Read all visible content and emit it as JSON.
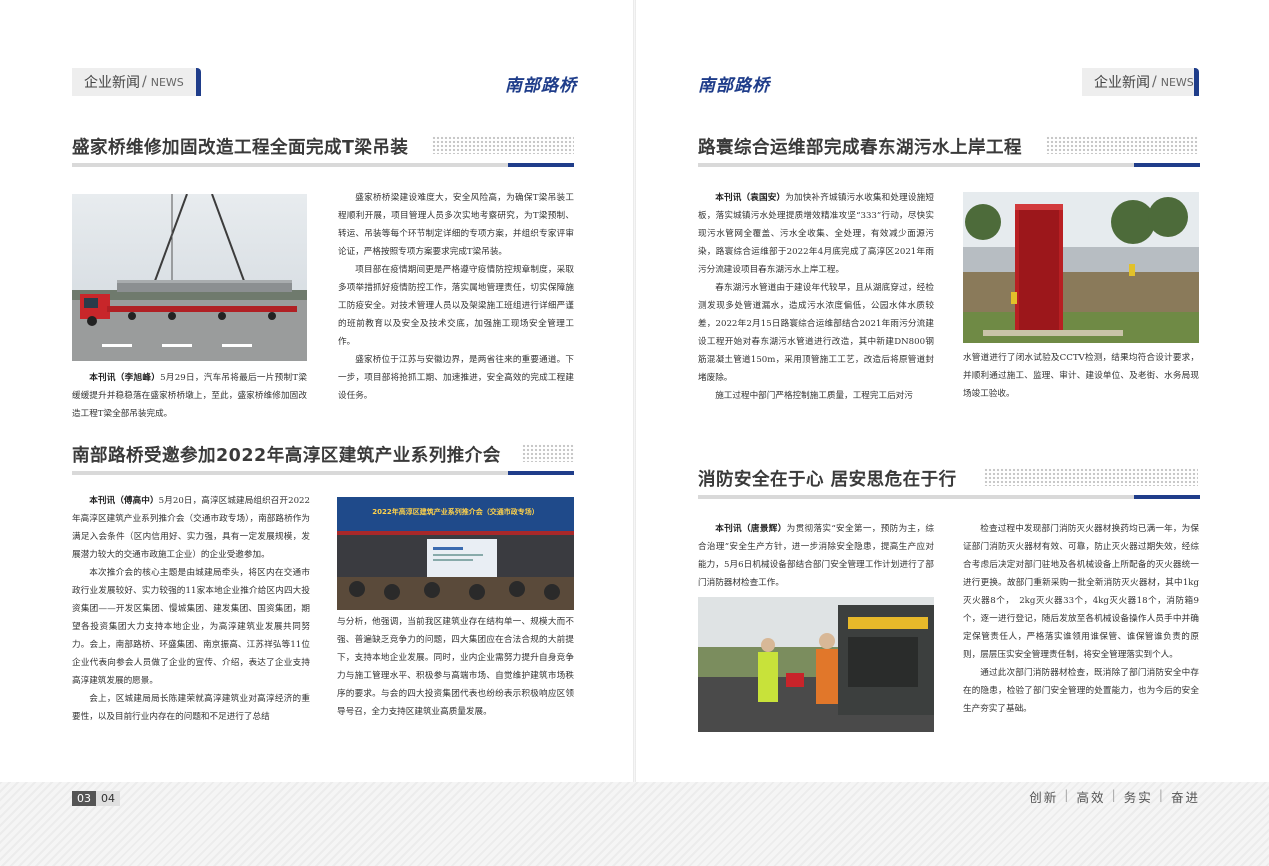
{
  "header": {
    "section_label": "企业新闻",
    "section_sub": "NEWS",
    "brand": "南部路桥"
  },
  "colors": {
    "accent": "#1f3d8a"
  },
  "article1": {
    "headline": "盛家桥维修加固改造工程全面完成T梁吊装",
    "caption_lead": "本刊讯（李旭峰）",
    "caption_body": "5月29日，汽车吊将最后一片预制T梁缓缓提升并稳稳落在盛家桥桥墩上，至此，盛家桥维修加固改造工程T梁全部吊装完成。",
    "paragraphs": [
      "盛家桥桥梁建设难度大，安全风险高，为确保T梁吊装工程顺利开展，项目管理人员多次实地考察研究，为T梁预制、转运、吊装等每个环节制定详细的专项方案，并组织专家评审论证，严格按照专项方案要求完成T梁吊装。",
      "项目部在疫情期间更是严格遵守疫情防控规章制度，采取多项举措抓好疫情防控工作，落实属地管理责任，切实保障施工防疫安全。对技术管理人员以及架梁施工班组进行详细严谨的班前教育以及安全及技术交底，加强施工现场安全管理工作。",
      "盛家桥位于江苏与安徽边界，是两省往来的重要通道。下一步，项目部将抢抓工期、加速推进，安全高效的完成工程建设任务。"
    ]
  },
  "article2": {
    "headline": "南部路桥受邀参加2022年高淳区建筑产业系列推介会",
    "lead": "本刊讯（傅高中）",
    "paragraph1_body": "5月20日，高淳区城建局组织召开2022年高淳区建筑产业系列推介会（交通市政专场），南部路桥作为满足入会条件（区内信用好、实力强，具有一定发展规模，发展潜力较大的交通市政施工企业）的企业受邀参加。",
    "paragraph2": "本次推介会的核心主题是由城建局牵头，将区内在交通市政行业发展较好、实力较强的11家本地企业推介给区内四大投资集团——开发区集团、慢城集团、建发集团、国资集团，期望各投资集团大力支持本地企业，为高淳建筑业发展共同努力。会上，南部路桥、环盛集团、南京振高、江苏祥弘等11位企业代表向参会人员做了企业的宣传、介绍，表达了企业支持高淳建筑发展的愿景。",
    "paragraph3": "会上，区城建局局长陈建荣就高淳建筑业对高淳经济的重要性，以及目前行业内存在的问题和不足进行了总结",
    "right_col": "与分析，他强调，当前我区建筑业存在结构单一、规模大而不强、普遍缺乏竞争力的问题，四大集团应在合法合规的大前提下，支持本地企业发展。同时，业内企业需努力提升自身竞争力与施工管理水平、积极参与高端市场、自觉维护建筑市场秩序的要求。与会的四大投资集团代表也纷纷表示积极响应区领导号召，全力支持区建筑业高质量发展。",
    "banner_text": "2022年高淳区建筑产业系列推介会（交通市政专场）"
  },
  "article3": {
    "headline": "路寰综合运维部完成春东湖污水上岸工程",
    "lead": "本刊讯（袁国安）",
    "paragraph1_body": "为加快补齐城镇污水收集和处理设施短板，落实城镇污水处理提质增效精准攻坚“333”行动，尽快实现污水管网全覆盖、污水全收集、全处理，有效减少面源污染，路寰综合运维部于2022年4月底完成了高淳区2021年雨污分流建设项目春东湖污水上岸工程。",
    "paragraph2": "春东湖污水管道由于建设年代较早，且从湖底穿过，经检测发现多处管道漏水，造成污水浓度偏低，公园水体水质较差，2022年2月15日路寰综合运维部结合2021年雨污分流建设工程开始对春东湖污水管道进行改造，其中新建DN800钢筋混凝土管道150m，采用顶管施工工艺，改造后将原管道封堵废除。",
    "paragraph3": "施工过程中部门严格控制施工质量，工程完工后对污",
    "right_col": "水管道进行了闭水试验及CCTV检测，结果均符合设计要求，并顺利通过施工、监理、审计、建设单位、及老街、水务局现场竣工验收。"
  },
  "article4": {
    "headline": "消防安全在于心 居安思危在于行",
    "lead": "本刊讯（唐景辉）",
    "paragraph1_body": "为贯彻落实“安全第一，预防为主，综合治理”安全生产方针，进一步消除安全隐患，提高生产应对能力，5月6日机械设备部结合部门安全管理工作计划进行了部门消防器材检查工作。",
    "right_paragraphs": [
      "检查过程中发现部门消防灭火器材换药均已满一年，为保证部门消防灭火器材有效、可靠，防止灭火器过期失效，经综合考虑后决定对部门驻地及各机械设备上所配备的灭火器统一进行更换。故部门重新采购一批全新消防灭火器材，其中1kg灭火器8个，　2kg灭火器33个，4kg灭火器18个，消防箱9个，逐一进行登记，随后发放至各机械设备操作人员手中并确定保管责任人，严格落实谁领用谁保管、谁保管谁负责的原则，层层压实安全管理责任制，将安全管理落实到个人。",
      "通过此次部门消防器材检查，既消除了部门消防安全中存在的隐患，检验了部门安全管理的处置能力，也为今后的安全生产夯实了基础。"
    ]
  },
  "footer": {
    "page_left": "03",
    "page_right": "04",
    "slogan": [
      "创新",
      "高效",
      "务实",
      "奋进"
    ],
    "separator": "|"
  }
}
